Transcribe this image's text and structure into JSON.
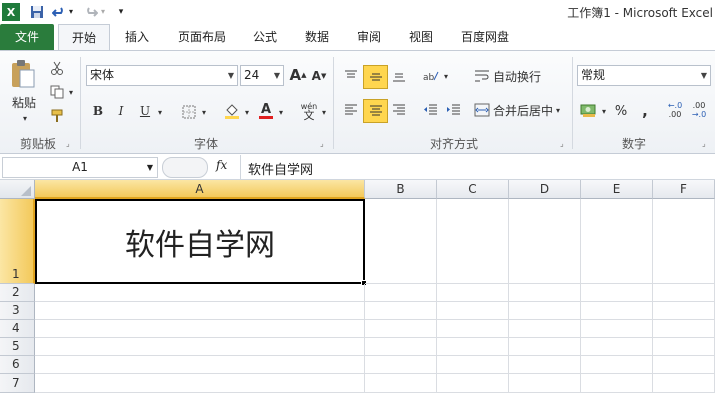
{
  "window": {
    "title": "工作簿1 - Microsoft Excel"
  },
  "tabs": [
    {
      "label": "文件"
    },
    {
      "label": "开始"
    },
    {
      "label": "插入"
    },
    {
      "label": "页面布局"
    },
    {
      "label": "公式"
    },
    {
      "label": "数据"
    },
    {
      "label": "审阅"
    },
    {
      "label": "视图"
    },
    {
      "label": "百度网盘"
    }
  ],
  "ribbon": {
    "clipboard": {
      "group_label": "剪贴板",
      "paste_label": "粘贴"
    },
    "font": {
      "group_label": "字体",
      "font_name": "宋体",
      "font_size": "24",
      "bold": "B",
      "italic": "I",
      "underline": "U",
      "grow": "A",
      "shrink": "A",
      "phonetic": "wén"
    },
    "alignment": {
      "group_label": "对齐方式",
      "wrap_text": "自动换行",
      "merge_center": "合并后居中"
    },
    "number": {
      "group_label": "数字",
      "format": "常规",
      "percent": "%",
      "comma": ","
    }
  },
  "formula_bar": {
    "name_box": "A1",
    "fx": "fx",
    "content": "软件自学网"
  },
  "grid": {
    "columns": [
      "A",
      "B",
      "C",
      "D",
      "E",
      "F"
    ],
    "rows": [
      "1",
      "2",
      "3",
      "4",
      "5",
      "6",
      "7"
    ],
    "cells": {
      "A1": "软件自学网"
    }
  },
  "colors": {
    "file_tab": "#2a7c3c",
    "selected_header": "#f9d77e",
    "accent": "#ffd64f"
  }
}
